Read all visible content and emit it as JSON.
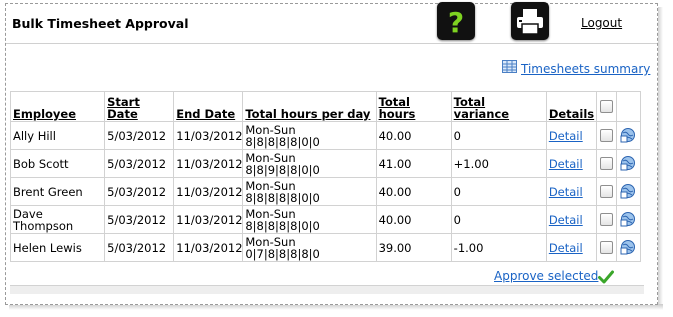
{
  "header": {
    "title": "Bulk Timesheet Approval",
    "help_icon": "help-question-icon",
    "print_icon": "printer-icon",
    "logout_label": "Logout"
  },
  "summary_link": {
    "icon": "table-icon",
    "label": "Timesheets summary"
  },
  "table": {
    "columns": [
      "Employee",
      "Start Date",
      "End Date",
      "Total hours per day",
      "Total hours",
      "Total variance",
      "Details"
    ],
    "rows": [
      {
        "employee": "Ally Hill",
        "start": "5/03/2012",
        "end": "11/03/2012",
        "days": "Mon-Sun",
        "hours_per_day": "8|8|8|8|8|0|0",
        "total_hours": "40.00",
        "variance": "0",
        "detail": "Detail"
      },
      {
        "employee": "Bob Scott",
        "start": "5/03/2012",
        "end": "11/03/2012",
        "days": "Mon-Sun",
        "hours_per_day": "8|8|9|8|8|0|0",
        "total_hours": "41.00",
        "variance": "+1.00",
        "detail": "Detail"
      },
      {
        "employee": "Brent Green",
        "start": "5/03/2012",
        "end": "11/03/2012",
        "days": "Mon-Sun",
        "hours_per_day": "8|8|8|8|8|0|0",
        "total_hours": "40.00",
        "variance": "0",
        "detail": "Detail"
      },
      {
        "employee": "Dave Thompson",
        "start": "5/03/2012",
        "end": "11/03/2012",
        "days": "Mon-Sun",
        "hours_per_day": "8|8|8|8|8|0|0",
        "total_hours": "40.00",
        "variance": "0",
        "detail": "Detail"
      },
      {
        "employee": "Helen Lewis",
        "start": "5/03/2012",
        "end": "11/03/2012",
        "days": "Mon-Sun",
        "hours_per_day": "0|7|8|8|8|8|0",
        "total_hours": "39.00",
        "variance": "-1.00",
        "detail": "Detail"
      }
    ]
  },
  "approve_selected_label": "Approve selected",
  "colors": {
    "link": "#1a63c5",
    "grid": "#d2d2d2"
  }
}
